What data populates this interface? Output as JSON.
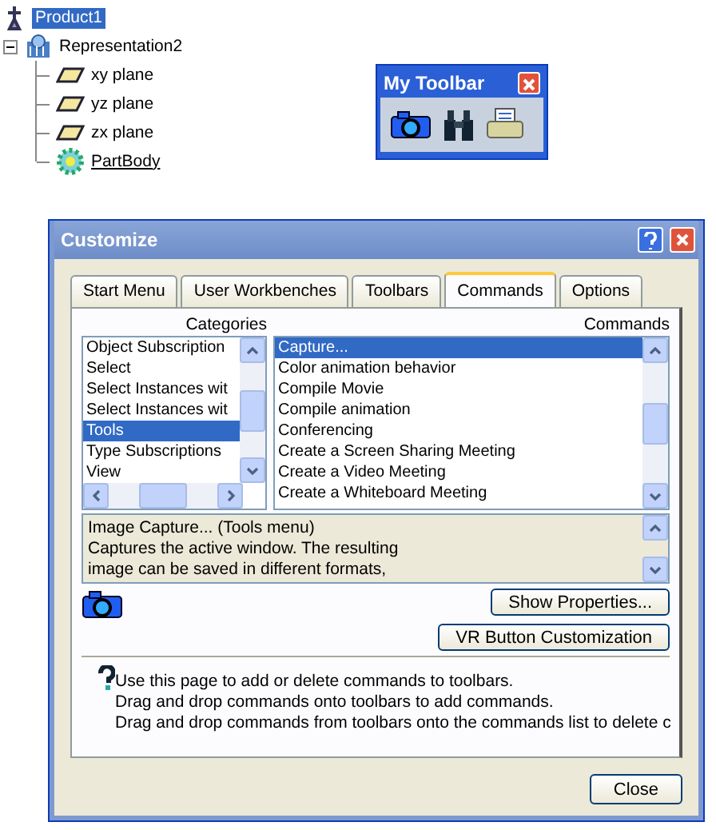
{
  "tree": {
    "label": "Product1",
    "selected": true,
    "children": [
      {
        "label": "Representation2",
        "kind": "representation",
        "selected": false,
        "expanded": true,
        "children": [
          {
            "label": "xy plane",
            "kind": "plane",
            "selected": false,
            "current": false
          },
          {
            "label": "yz plane",
            "kind": "plane",
            "selected": false,
            "current": false
          },
          {
            "label": "zx plane",
            "kind": "plane",
            "selected": false,
            "current": false
          },
          {
            "label": "PartBody",
            "kind": "body",
            "selected": false,
            "current": true
          }
        ]
      }
    ]
  },
  "toolbar": {
    "title": "My Toolbar",
    "buttons": [
      {
        "kind": "camera"
      },
      {
        "kind": "binoculars"
      },
      {
        "kind": "printer"
      }
    ]
  },
  "dialog": {
    "title": "Customize",
    "tabs": [
      {
        "label": "Start Menu",
        "selected": false
      },
      {
        "label": "User Workbenches",
        "selected": false
      },
      {
        "label": "Toolbars",
        "selected": false
      },
      {
        "label": "Commands",
        "selected": true
      },
      {
        "label": "Options",
        "selected": false
      }
    ],
    "categories_label": "Categories",
    "commands_label": "Commands",
    "categories": [
      {
        "label": "Object Subscription",
        "selected": false
      },
      {
        "label": "Select",
        "selected": false
      },
      {
        "label": "Select Instances wit",
        "selected": false
      },
      {
        "label": "Select Instances wit",
        "selected": false
      },
      {
        "label": "Tools",
        "selected": true
      },
      {
        "label": "Type Subscriptions",
        "selected": false
      },
      {
        "label": "View",
        "selected": false
      }
    ],
    "commands": [
      {
        "label": "Capture...",
        "selected": true
      },
      {
        "label": "Color animation behavior",
        "selected": false
      },
      {
        "label": "Compile Movie",
        "selected": false
      },
      {
        "label": "Compile animation",
        "selected": false
      },
      {
        "label": "Conferencing",
        "selected": false
      },
      {
        "label": "Create a Screen Sharing Meeting",
        "selected": false
      },
      {
        "label": "Create a Video Meeting",
        "selected": false
      },
      {
        "label": "Create a Whiteboard Meeting",
        "selected": false
      }
    ],
    "description": [
      "Image Capture... (Tools menu)",
      "Captures the active window. The resulting",
      "image can be saved in different formats,"
    ],
    "show_properties": "Show Properties...",
    "vr_button": "VR Button Customization",
    "help": [
      "Use this page to add or delete commands to toolbars.",
      "Drag and drop commands onto toolbars to add commands.",
      "Drag and drop commands from toolbars onto the commands list to delete c"
    ],
    "close": "Close"
  }
}
